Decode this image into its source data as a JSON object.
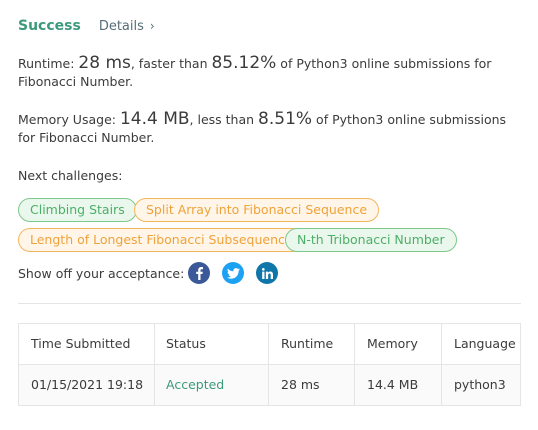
{
  "header": {
    "status": "Success",
    "details_label": "Details",
    "details_chevron": "›"
  },
  "runtime": {
    "label": "Runtime:",
    "value": "28 ms",
    "comparison": ", faster than",
    "percent": "85.12%",
    "suffix": "of Python3 online submissions for Fibonacci Number."
  },
  "memory": {
    "label": "Memory Usage:",
    "value": "14.4 MB",
    "comparison": ", less than",
    "percent": "8.51%",
    "suffix": "of Python3 online submissions for Fibonacci Number."
  },
  "next_challenges": {
    "title": "Next challenges:",
    "items": [
      {
        "label": "Climbing Stairs",
        "difficulty_color": "#4caf68"
      },
      {
        "label": "Split Array into Fibonacci Sequence",
        "difficulty_color": "#f0a23a"
      },
      {
        "label": "Length of Longest Fibonacci Subsequence",
        "difficulty_color": "#f0a23a"
      },
      {
        "label": "N-th Tribonacci Number",
        "difficulty_color": "#4caf68"
      }
    ]
  },
  "share": {
    "label": "Show off your acceptance:",
    "icons": [
      "facebook-icon",
      "twitter-icon",
      "linkedin-icon"
    ]
  },
  "submissions_table": {
    "headers": [
      "Time Submitted",
      "Status",
      "Runtime",
      "Memory",
      "Language"
    ],
    "rows": [
      [
        "01/15/2021 19:18",
        "Accepted",
        "28 ms",
        "14.4 MB",
        "python3"
      ]
    ]
  },
  "colors": {
    "success": "#3c9a7c",
    "easy": "#4caf68",
    "medium": "#f0a23a",
    "facebook": "#3b5998",
    "twitter": "#1da1f2",
    "linkedin": "#0e76a8"
  }
}
